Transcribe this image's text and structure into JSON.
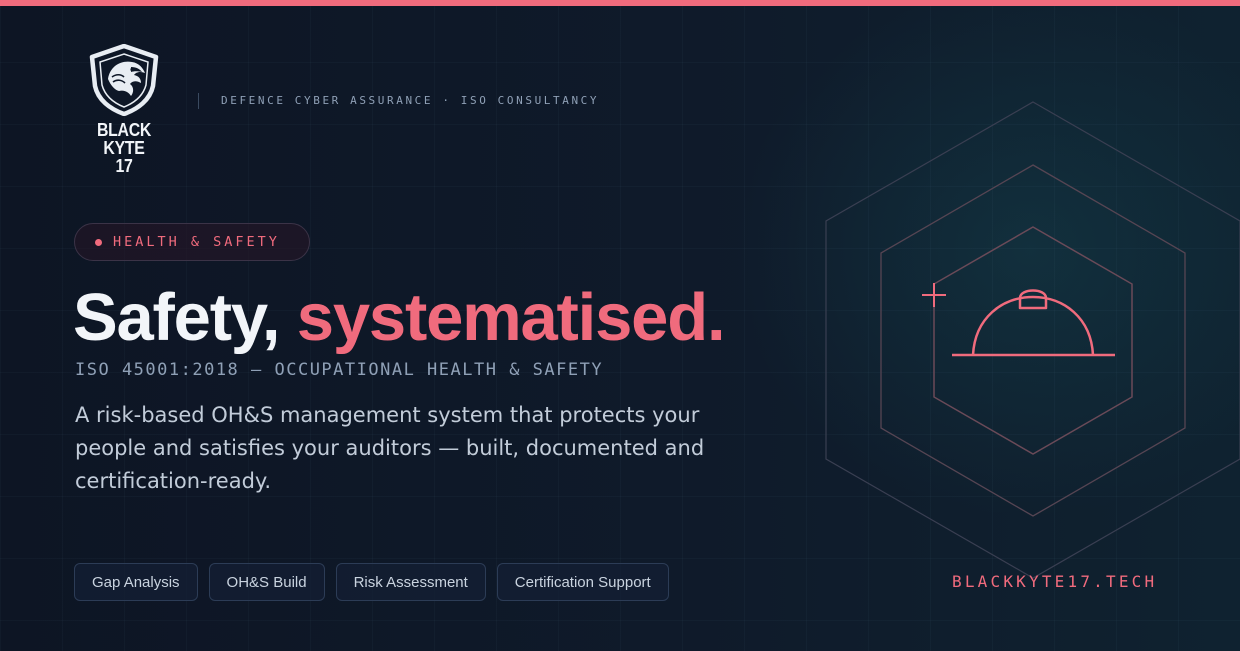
{
  "brand": {
    "logo_icon": "eagle-shield-icon",
    "name": "BLACK KYTE",
    "number": "17"
  },
  "header": {
    "tagline": "DEFENCE CYBER ASSURANCE · ISO CONSULTANCY"
  },
  "badge": {
    "label": "HEALTH & SAFETY"
  },
  "headline": {
    "part1": "Safety, ",
    "part2": "systematised."
  },
  "subtitle": "ISO 45001:2018 — OCCUPATIONAL HEALTH & SAFETY",
  "description": "A risk-based OH&S management system that protects your people and satisfies your auditors — built, documented and certification-ready.",
  "services": [
    "Gap Analysis",
    "OH&S Build",
    "Risk Assessment",
    "Certification Support"
  ],
  "footer": {
    "domain": "BLACKKYTE17.TECH"
  },
  "illustration": {
    "icon": "hard-hat-icon",
    "frame": "nested-hexagons",
    "decor": "plus-icon"
  },
  "colors": {
    "accent": "#f06b7d",
    "background": "#0e1727",
    "text": "#f2f5f9",
    "muted": "#8fa0b6"
  }
}
